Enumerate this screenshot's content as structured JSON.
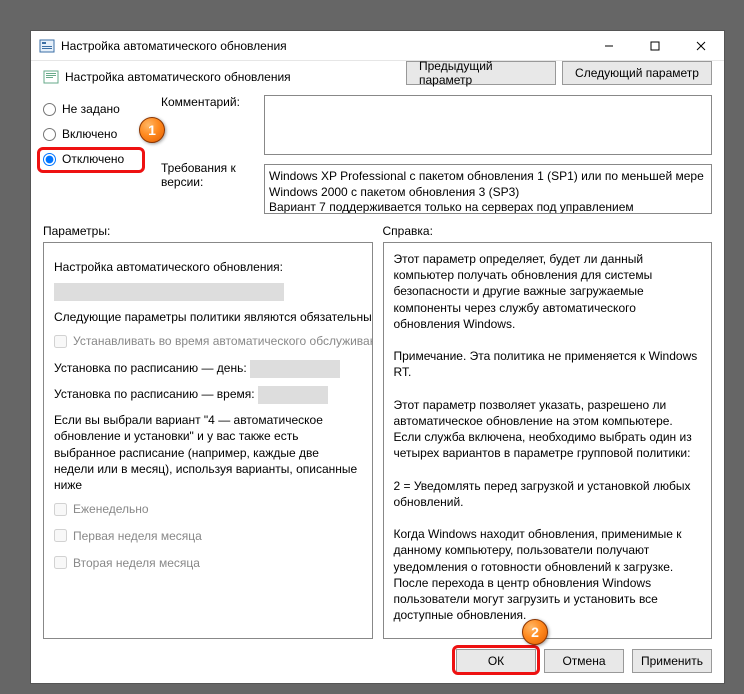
{
  "window": {
    "title": "Настройка автоматического обновления",
    "policy_title": "Настройка автоматического обновления"
  },
  "nav": {
    "prev": "Предыдущий параметр",
    "next": "Следующий параметр"
  },
  "radios": {
    "not_configured": "Не задано",
    "enabled": "Включено",
    "disabled": "Отключено"
  },
  "labels": {
    "comment": "Комментарий:",
    "requirements": "Требования к версии:",
    "options": "Параметры:",
    "help": "Справка:"
  },
  "requirements_text": "Windows XP Professional с пакетом обновления 1 (SP1) или по меньшей мере Windows 2000 с пакетом обновления 3 (SP3)\nВариант 7 поддерживается только на серверах под управлением",
  "options": {
    "heading": "Настройка автоматического обновления:",
    "line_required": "Следующие параметры политики являются обязательными",
    "cb_install_maint": "Устанавливать во время автоматического обслуживания",
    "line_day": "Установка по расписанию — день:",
    "line_time": "Установка по расписанию — время:",
    "line_note": "Если вы выбрали вариант \"4 — автоматическое обновление и установки\" и у вас также есть выбранное расписание (например, каждые две недели или в месяц), используя варианты, описанные ниже",
    "cb_weekly": "Еженедельно",
    "cb_first_week": "Первая неделя месяца",
    "cb_second_week": "Вторая неделя месяца"
  },
  "help_text": "Этот параметр определяет, будет ли данный компьютер получать обновления для системы безопасности и другие важные загружаемые компоненты через службу автоматического обновления Windows.\n\nПримечание. Эта политика не применяется к Windows RT.\n\nЭтот параметр позволяет указать, разрешено ли автоматическое обновление на этом компьютере. Если служба включена, необходимо выбрать один из четырех вариантов в параметре групповой политики:\n\n        2 = Уведомлять перед загрузкой и установкой любых обновлений.\n\n        Когда Windows находит обновления, применимые к данному компьютеру, пользователи получают уведомления о готовности обновлений к загрузке. После перехода в центр обновления Windows пользователи могут загрузить и установить все доступные обновления.",
  "footer": {
    "ok": "ОК",
    "cancel": "Отмена",
    "apply": "Применить"
  },
  "steps": {
    "one": "1",
    "two": "2"
  }
}
